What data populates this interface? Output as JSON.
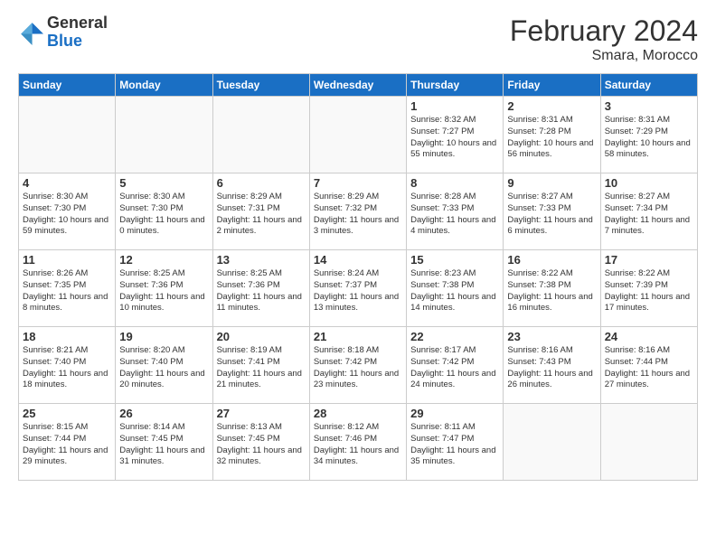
{
  "header": {
    "logo_general": "General",
    "logo_blue": "Blue",
    "month_title": "February 2024",
    "location": "Smara, Morocco"
  },
  "days_of_week": [
    "Sunday",
    "Monday",
    "Tuesday",
    "Wednesday",
    "Thursday",
    "Friday",
    "Saturday"
  ],
  "weeks": [
    [
      {
        "day": "",
        "info": "",
        "empty": true
      },
      {
        "day": "",
        "info": "",
        "empty": true
      },
      {
        "day": "",
        "info": "",
        "empty": true
      },
      {
        "day": "",
        "info": "",
        "empty": true
      },
      {
        "day": "1",
        "info": "Sunrise: 8:32 AM\nSunset: 7:27 PM\nDaylight: 10 hours\nand 55 minutes."
      },
      {
        "day": "2",
        "info": "Sunrise: 8:31 AM\nSunset: 7:28 PM\nDaylight: 10 hours\nand 56 minutes."
      },
      {
        "day": "3",
        "info": "Sunrise: 8:31 AM\nSunset: 7:29 PM\nDaylight: 10 hours\nand 58 minutes."
      }
    ],
    [
      {
        "day": "4",
        "info": "Sunrise: 8:30 AM\nSunset: 7:30 PM\nDaylight: 10 hours\nand 59 minutes."
      },
      {
        "day": "5",
        "info": "Sunrise: 8:30 AM\nSunset: 7:30 PM\nDaylight: 11 hours\nand 0 minutes."
      },
      {
        "day": "6",
        "info": "Sunrise: 8:29 AM\nSunset: 7:31 PM\nDaylight: 11 hours\nand 2 minutes."
      },
      {
        "day": "7",
        "info": "Sunrise: 8:29 AM\nSunset: 7:32 PM\nDaylight: 11 hours\nand 3 minutes."
      },
      {
        "day": "8",
        "info": "Sunrise: 8:28 AM\nSunset: 7:33 PM\nDaylight: 11 hours\nand 4 minutes."
      },
      {
        "day": "9",
        "info": "Sunrise: 8:27 AM\nSunset: 7:33 PM\nDaylight: 11 hours\nand 6 minutes."
      },
      {
        "day": "10",
        "info": "Sunrise: 8:27 AM\nSunset: 7:34 PM\nDaylight: 11 hours\nand 7 minutes."
      }
    ],
    [
      {
        "day": "11",
        "info": "Sunrise: 8:26 AM\nSunset: 7:35 PM\nDaylight: 11 hours\nand 8 minutes."
      },
      {
        "day": "12",
        "info": "Sunrise: 8:25 AM\nSunset: 7:36 PM\nDaylight: 11 hours\nand 10 minutes."
      },
      {
        "day": "13",
        "info": "Sunrise: 8:25 AM\nSunset: 7:36 PM\nDaylight: 11 hours\nand 11 minutes."
      },
      {
        "day": "14",
        "info": "Sunrise: 8:24 AM\nSunset: 7:37 PM\nDaylight: 11 hours\nand 13 minutes."
      },
      {
        "day": "15",
        "info": "Sunrise: 8:23 AM\nSunset: 7:38 PM\nDaylight: 11 hours\nand 14 minutes."
      },
      {
        "day": "16",
        "info": "Sunrise: 8:22 AM\nSunset: 7:38 PM\nDaylight: 11 hours\nand 16 minutes."
      },
      {
        "day": "17",
        "info": "Sunrise: 8:22 AM\nSunset: 7:39 PM\nDaylight: 11 hours\nand 17 minutes."
      }
    ],
    [
      {
        "day": "18",
        "info": "Sunrise: 8:21 AM\nSunset: 7:40 PM\nDaylight: 11 hours\nand 18 minutes."
      },
      {
        "day": "19",
        "info": "Sunrise: 8:20 AM\nSunset: 7:40 PM\nDaylight: 11 hours\nand 20 minutes."
      },
      {
        "day": "20",
        "info": "Sunrise: 8:19 AM\nSunset: 7:41 PM\nDaylight: 11 hours\nand 21 minutes."
      },
      {
        "day": "21",
        "info": "Sunrise: 8:18 AM\nSunset: 7:42 PM\nDaylight: 11 hours\nand 23 minutes."
      },
      {
        "day": "22",
        "info": "Sunrise: 8:17 AM\nSunset: 7:42 PM\nDaylight: 11 hours\nand 24 minutes."
      },
      {
        "day": "23",
        "info": "Sunrise: 8:16 AM\nSunset: 7:43 PM\nDaylight: 11 hours\nand 26 minutes."
      },
      {
        "day": "24",
        "info": "Sunrise: 8:16 AM\nSunset: 7:44 PM\nDaylight: 11 hours\nand 27 minutes."
      }
    ],
    [
      {
        "day": "25",
        "info": "Sunrise: 8:15 AM\nSunset: 7:44 PM\nDaylight: 11 hours\nand 29 minutes."
      },
      {
        "day": "26",
        "info": "Sunrise: 8:14 AM\nSunset: 7:45 PM\nDaylight: 11 hours\nand 31 minutes."
      },
      {
        "day": "27",
        "info": "Sunrise: 8:13 AM\nSunset: 7:45 PM\nDaylight: 11 hours\nand 32 minutes."
      },
      {
        "day": "28",
        "info": "Sunrise: 8:12 AM\nSunset: 7:46 PM\nDaylight: 11 hours\nand 34 minutes."
      },
      {
        "day": "29",
        "info": "Sunrise: 8:11 AM\nSunset: 7:47 PM\nDaylight: 11 hours\nand 35 minutes."
      },
      {
        "day": "",
        "info": "",
        "empty": true
      },
      {
        "day": "",
        "info": "",
        "empty": true
      }
    ]
  ]
}
